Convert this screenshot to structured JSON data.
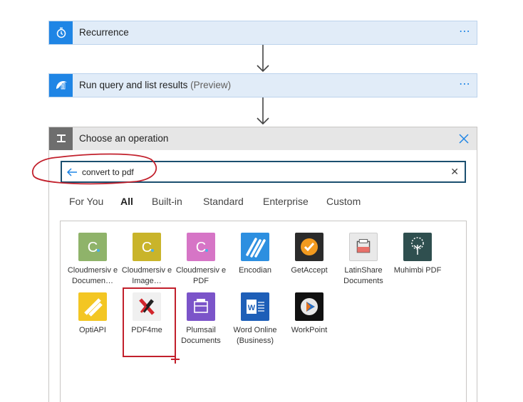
{
  "steps": [
    {
      "title": "Recurrence",
      "icon": "clock-icon",
      "more": "⋯"
    },
    {
      "title": "Run query and list results",
      "subtitle": "(Preview)",
      "icon": "log-analytics-icon",
      "more": "⋯"
    }
  ],
  "chooser": {
    "title": "Choose an operation",
    "close_icon": "close-icon",
    "search": {
      "value": "convert to pdf",
      "clear": "✕"
    },
    "tabs": [
      {
        "label": "For You",
        "active": false
      },
      {
        "label": "All",
        "active": true
      },
      {
        "label": "Built-in",
        "active": false
      },
      {
        "label": "Standard",
        "active": false
      },
      {
        "label": "Enterprise",
        "active": false
      },
      {
        "label": "Custom",
        "active": false
      }
    ],
    "connectors": [
      {
        "label": "Cloudmersiv e Documen…",
        "icon": "cloudmersive-document-icon",
        "color": "#8fb36a",
        "glyph": "C"
      },
      {
        "label": "Cloudmersiv e Image…",
        "icon": "cloudmersive-image-icon",
        "color": "#c9b42a",
        "glyph": "C"
      },
      {
        "label": "Cloudmersiv e PDF",
        "icon": "cloudmersive-pdf-icon",
        "color": "#d675c6",
        "glyph": "C"
      },
      {
        "label": "Encodian",
        "icon": "encodian-icon",
        "color": "#2d8fe0",
        "glyph": ""
      },
      {
        "label": "GetAccept",
        "icon": "getaccept-icon",
        "color": "#2b2b2b",
        "glyph": "✓"
      },
      {
        "label": "LatinShare Documents",
        "icon": "latinshare-icon",
        "color": "#e9e9e9",
        "glyph": ""
      },
      {
        "label": "Muhimbi PDF",
        "icon": "muhimbi-tree-icon",
        "color": "#2f4f4f",
        "glyph": ""
      },
      {
        "label": "OptiAPI",
        "icon": "optiapi-icon",
        "color": "#f3c623",
        "glyph": ""
      },
      {
        "label": "PDF4me",
        "icon": "pdf4me-icon",
        "color": "#f0f0f0",
        "glyph": ""
      },
      {
        "label": "Plumsail Documents",
        "icon": "plumsail-icon",
        "color": "#7b54c9",
        "glyph": ""
      },
      {
        "label": "Word Online (Business)",
        "icon": "word-online-icon",
        "color": "#1e5fb8",
        "glyph": "W"
      },
      {
        "label": "WorkPoint",
        "icon": "workpoint-icon",
        "color": "#111111",
        "glyph": ""
      }
    ]
  },
  "colors": {
    "accent": "#1f85e5",
    "step_bg": "#e1ecf8",
    "annotation_red": "#c2202c"
  }
}
